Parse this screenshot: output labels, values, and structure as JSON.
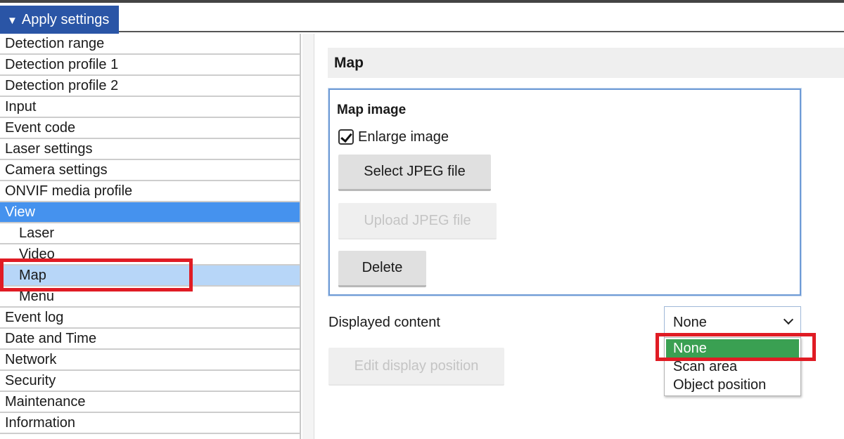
{
  "header": {
    "apply_label": "Apply settings"
  },
  "sidebar": {
    "items": [
      {
        "label": "Detection range"
      },
      {
        "label": "Detection profile 1"
      },
      {
        "label": "Detection profile 2"
      },
      {
        "label": "Input"
      },
      {
        "label": "Event code"
      },
      {
        "label": "Laser settings"
      },
      {
        "label": "Camera settings"
      },
      {
        "label": "ONVIF media profile"
      },
      {
        "label": "View",
        "state": "active"
      },
      {
        "label": "Laser",
        "sub": true
      },
      {
        "label": "Video",
        "sub": true
      },
      {
        "label": "Map",
        "sub": true,
        "state": "current"
      },
      {
        "label": "Menu",
        "sub": true
      },
      {
        "label": "Event log"
      },
      {
        "label": "Date and Time"
      },
      {
        "label": "Network"
      },
      {
        "label": "Security"
      },
      {
        "label": "Maintenance"
      },
      {
        "label": "Information"
      }
    ]
  },
  "panel": {
    "title": "Map",
    "map_image": {
      "title": "Map image",
      "enlarge_label": "Enlarge image",
      "enlarge_checked": true,
      "select_label": "Select JPEG file",
      "upload_label": "Upload JPEG file",
      "delete_label": "Delete"
    },
    "displayed_content": {
      "label": "Displayed content",
      "selected": "None",
      "options": [
        "None",
        "Scan area",
        "Object position"
      ]
    },
    "edit_position_label": "Edit display position"
  },
  "colors": {
    "apply_bg": "#2a55a6",
    "nav_active": "#4592ee",
    "nav_current": "#b7d6f8",
    "option_selected": "#3aa052",
    "highlight": "#e01c24"
  }
}
